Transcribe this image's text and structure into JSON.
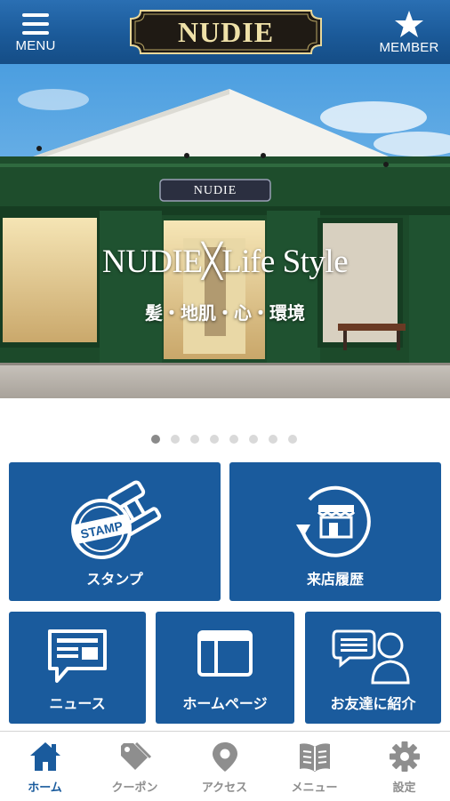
{
  "header": {
    "menu_label": "MENU",
    "brand": "NUDIE",
    "member_label": "MEMBER"
  },
  "hero": {
    "title": "NUDIE╳Life Style",
    "subtitle": "髪・地肌・心・環境",
    "storefront_sign": "NUDIE",
    "slides_total": 8,
    "active_slide": 1
  },
  "tiles": {
    "stamp": {
      "label": "スタンプ",
      "icon_text": "STAMP"
    },
    "visit_history": {
      "label": "来店履歴"
    },
    "news": {
      "label": "ニュース"
    },
    "homepage": {
      "label": "ホームページ"
    },
    "refer_friend": {
      "label": "お友達に紹介"
    }
  },
  "bottom_nav": [
    {
      "id": "home",
      "label": "ホーム",
      "icon": "home-icon",
      "active": true
    },
    {
      "id": "coupon",
      "label": "クーポン",
      "icon": "tag-icon",
      "active": false
    },
    {
      "id": "access",
      "label": "アクセス",
      "icon": "map-pin-icon",
      "active": false
    },
    {
      "id": "menu",
      "label": "メニュー",
      "icon": "book-icon",
      "active": false
    },
    {
      "id": "settings",
      "label": "設定",
      "icon": "gear-icon",
      "active": false
    }
  ],
  "colors": {
    "header_blue": "#1b5a99",
    "tile_blue": "#1a5b9d",
    "active_nav": "#1a5b9d",
    "inactive_nav": "#8e8e8e",
    "logo_gold": "#efe1a8",
    "logo_plate": "#1f1a14"
  }
}
